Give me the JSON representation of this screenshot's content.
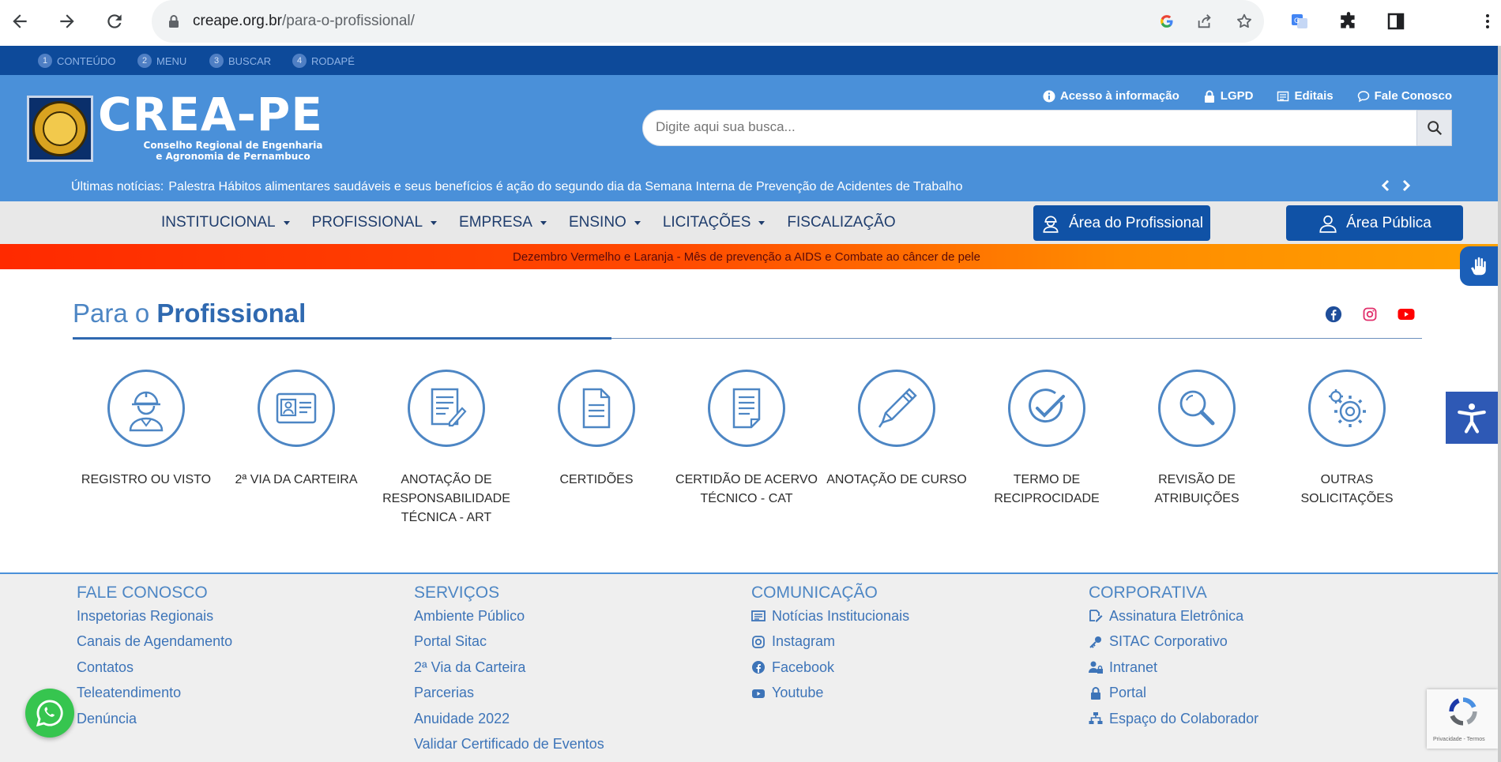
{
  "browser": {
    "url_host": "creape.org.br",
    "url_path": "/para-o-profissional/"
  },
  "skipbar": [
    {
      "num": "1",
      "label": "CONTEÚDO"
    },
    {
      "num": "2",
      "label": "MENU"
    },
    {
      "num": "3",
      "label": "BUSCAR"
    },
    {
      "num": "4",
      "label": "RODAPÉ"
    }
  ],
  "header": {
    "logo_title": "CREA-PE",
    "logo_sub_1": "Conselho Regional de Engenharia",
    "logo_sub_2": "e Agronomia de Pernambuco",
    "toplinks": [
      "Acesso à informação",
      "LGPD",
      "Editais",
      "Fale Conosco"
    ],
    "search_placeholder": "Digite aqui sua busca...",
    "news_label": "Últimas notícias:",
    "news_text": "Palestra Hábitos alimentares saudáveis e seus benefícios é ação do segundo dia da Semana Interna de Prevenção de Acidentes de Trabalho"
  },
  "nav": {
    "items": [
      "INSTITUCIONAL",
      "PROFISSIONAL",
      "EMPRESA",
      "ENSINO",
      "LICITAÇÕES",
      "FISCALIZAÇÃO"
    ],
    "area_profissional": "Área do Profissional",
    "area_publica": "Área Pública"
  },
  "alert": "Dezembro Vermelho e Laranja - Mês de prevenção a AIDS e Combate ao câncer de pele",
  "page": {
    "title_light": "Para o",
    "title_bold": "Profissional"
  },
  "services": [
    {
      "icon": "engineer-icon",
      "line1": "REGISTRO OU VISTO",
      "line2": "",
      "line3": ""
    },
    {
      "icon": "id-card-icon",
      "line1": "2ª VIA DA CARTEIRA",
      "line2": "",
      "line3": ""
    },
    {
      "icon": "document-pen-icon",
      "line1": "ANOTAÇÃO DE",
      "line2": "RESPONSABILIDADE",
      "line3": "TÉCNICA - ART"
    },
    {
      "icon": "document-icon",
      "line1": "CERTIDÕES",
      "line2": "",
      "line3": ""
    },
    {
      "icon": "document-folded-icon",
      "line1": "CERTIDÃO DE ACERVO",
      "line2": "TÉCNICO - CAT",
      "line3": ""
    },
    {
      "icon": "pen-icon",
      "line1": "ANOTAÇÃO DE CURSO",
      "line2": "",
      "line3": ""
    },
    {
      "icon": "check-icon",
      "line1": "TERMO DE",
      "line2": "RECIPROCIDADE",
      "line3": ""
    },
    {
      "icon": "magnifier-icon",
      "line1": "REVISÃO DE",
      "line2": "ATRIBUIÇÕES",
      "line3": ""
    },
    {
      "icon": "gears-icon",
      "line1": "OUTRAS",
      "line2": "SOLICITAÇÕES",
      "line3": ""
    }
  ],
  "footer": {
    "fale": {
      "title": "FALE CONOSCO",
      "links": [
        "Inspetorias Regionais",
        "Canais de Agendamento",
        "Contatos",
        "Teleatendimento",
        "Denúncia"
      ]
    },
    "servicos": {
      "title": "SERVIÇOS",
      "links": [
        "Ambiente Público",
        "Portal Sitac",
        "2ª Via da Carteira",
        "Parcerias",
        "Anuidade 2022",
        "Validar Certificado de Eventos"
      ]
    },
    "comunicacao": {
      "title": "COMUNICAÇÃO",
      "links": [
        "Notícias Institucionais",
        "Instagram",
        "Facebook",
        "Youtube"
      ]
    },
    "corporativa": {
      "title": "CORPORATIVA",
      "links": [
        "Assinatura Eletrônica",
        "SITAC Corporativo",
        "Intranet",
        "Portal",
        "Espaço do Colaborador"
      ]
    }
  },
  "recaptcha": "Privacidade - Termos",
  "colors": {
    "header": "#4a90d9",
    "skipbar": "#0d4a9a",
    "button": "#1052a6",
    "accent": "#2f69b0"
  }
}
